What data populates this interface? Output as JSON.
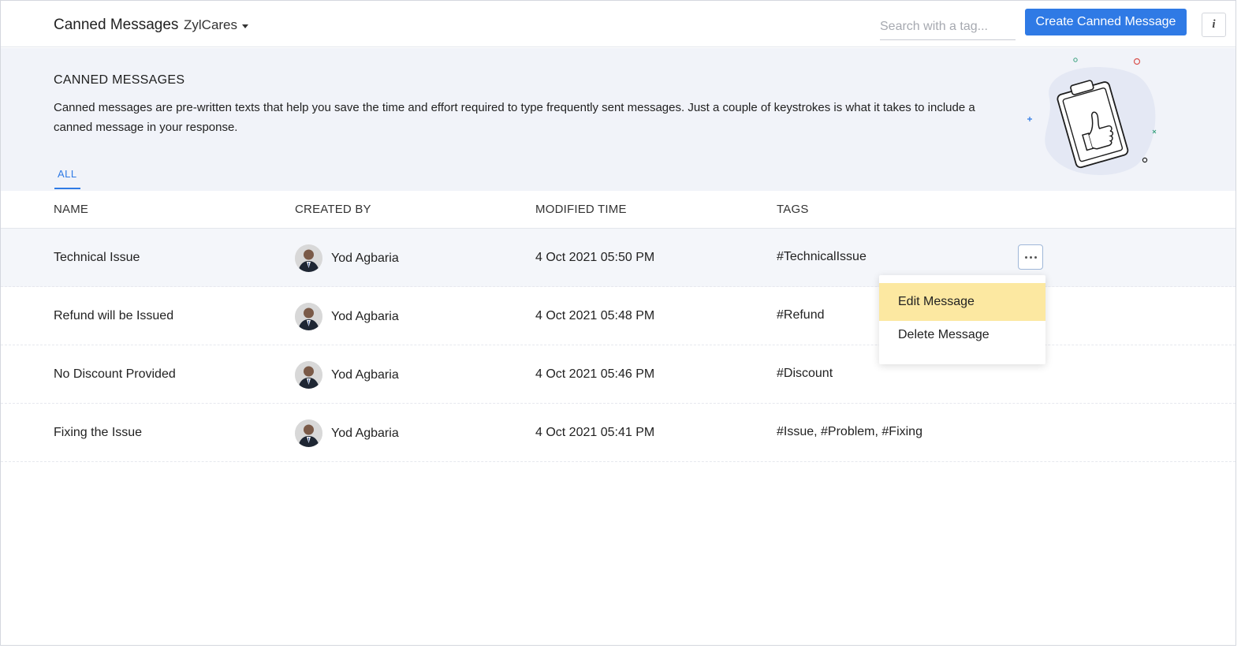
{
  "header": {
    "title": "Canned Messages",
    "department": "ZylCares",
    "search_placeholder": "Search with a tag...",
    "create_label": "Create Canned Message",
    "info_label": "i"
  },
  "banner": {
    "title": "CANNED MESSAGES",
    "description": "Canned messages are pre-written texts that help you save the time and effort required to type frequently sent messages. Just a couple of keystrokes is what it takes to include a canned message in your response.",
    "tab": "ALL"
  },
  "table": {
    "columns": [
      "NAME",
      "CREATED BY",
      "MODIFIED TIME",
      "TAGS"
    ],
    "rows": [
      {
        "name": "Technical Issue",
        "created_by": "Yod Agbaria",
        "modified": "4 Oct 2021 05:50 PM",
        "tags": "#TechnicalIssue"
      },
      {
        "name": "Refund will be Issued",
        "created_by": "Yod Agbaria",
        "modified": "4 Oct 2021 05:48 PM",
        "tags": "#Refund"
      },
      {
        "name": "No Discount Provided",
        "created_by": "Yod Agbaria",
        "modified": "4 Oct 2021 05:46 PM",
        "tags": "#Discount"
      },
      {
        "name": "Fixing the Issue",
        "created_by": "Yod Agbaria",
        "modified": "4 Oct 2021 05:41 PM",
        "tags": "#Issue, #Problem, #Fixing"
      }
    ]
  },
  "menu": {
    "edit_label": "Edit Message",
    "delete_label": "Delete Message"
  },
  "colors": {
    "accent": "#2f7ae5",
    "banner_bg": "#f1f3f9",
    "menu_highlight": "#fce8a1"
  }
}
